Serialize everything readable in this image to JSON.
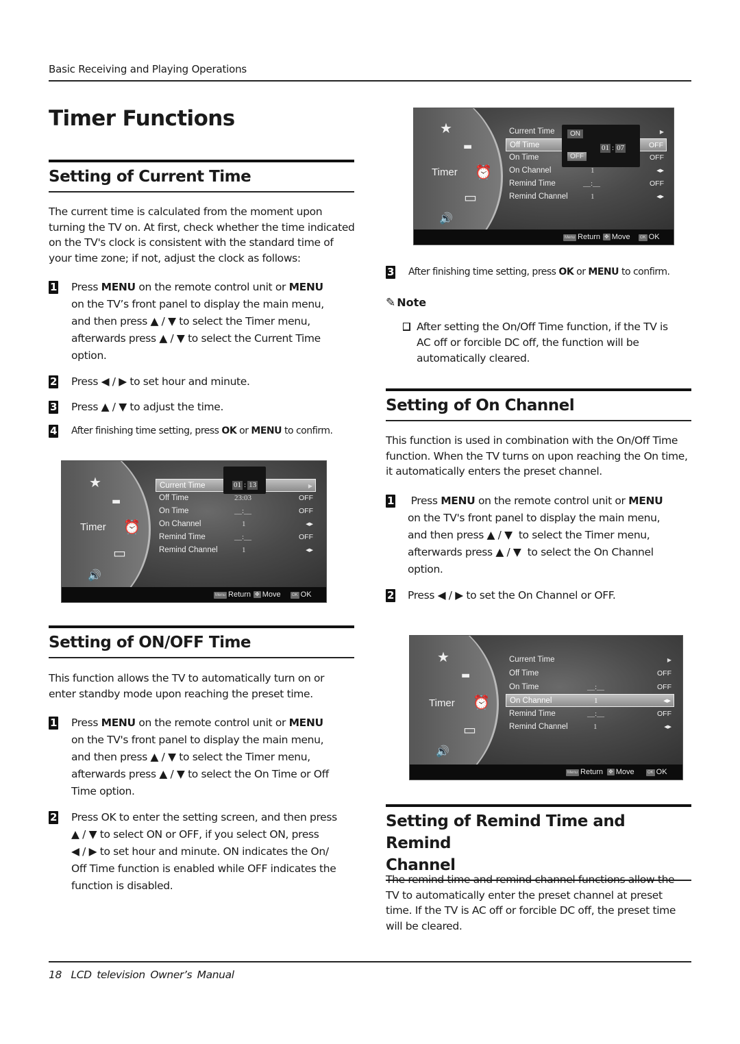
{
  "header": {
    "section": "Basic Receiving and Playing Operations"
  },
  "page_title": "Timer Functions",
  "current_time": {
    "heading": "Setting of Current Time",
    "intro": "The current time is calculated from the moment upon turning the TV on. At first, check whether the time indicated on the TV's clock is consistent with the standard time of your time zone; if not, adjust the clock as follows:",
    "steps": [
      {
        "num": "1",
        "lines": [
          "Press MENU on the remote control unit or MENU",
          "on the TV’s front panel to display the main menu,",
          "and then press ▲ / ▼  to select the Timer menu,",
          "afterwards press ▲ / ▼  to select the Current Time",
          "option."
        ]
      },
      {
        "num": "2",
        "text": "Press ◀ / ▶ to set hour and minute."
      },
      {
        "num": "3",
        "text": "Press ▲ / ▼  to adjust the time."
      },
      {
        "num": "4",
        "text": "After finishing time setting, press OK or MENU to confirm."
      }
    ]
  },
  "on_off_time": {
    "heading": "Setting of ON/OFF Time",
    "intro": "This function allows the TV to automatically turn on or enter standby mode upon reaching the preset time.",
    "steps": [
      {
        "num": "1",
        "lines": [
          "Press MENU on the remote control unit or MENU",
          "on the TV's front panel to display the main menu,",
          "and then press ▲ / ▼  to select the Timer menu,",
          "afterwards press ▲ / ▼  to select the On Time or Off",
          "Time option."
        ]
      },
      {
        "num": "2",
        "lines": [
          "Press OK to enter the setting screen, and then press",
          "▲ / ▼ to select ON or OFF, if you select ON, press",
          "◀ / ▶  to set hour and minute. ON indicates the On/",
          "Off Time function is enabled while OFF indicates the",
          "function is disabled."
        ]
      }
    ],
    "step3": {
      "num": "3",
      "text": "After finishing time setting, press OK or MENU to confirm."
    },
    "note": {
      "heading": "Note",
      "item": "After setting the On/Off Time function, if the TV is AC off or forcible DC off, the function will be automatically cleared."
    }
  },
  "on_channel": {
    "heading": "Setting of On Channel",
    "intro": "This function is used in combination with the On/Off Time function. When the TV turns on upon reaching the On time, it automatically enters the preset channel.",
    "steps": [
      {
        "num": "1",
        "lines": [
          " Press MENU on the remote control unit or MENU",
          "on the TV's front panel to display the main menu,",
          "and then press ▲ / ▼  to select the Timer menu,",
          "afterwards press ▲ / ▼  to select the On Channel",
          "option."
        ]
      },
      {
        "num": "2",
        "text": "Press ◀ / ▶ to set the On Channel or OFF."
      }
    ]
  },
  "remind": {
    "heading_line1": "Setting of Remind Time and Remind",
    "heading_line2": "Channel",
    "intro": "The remind time and remind channel functions allow the TV to automatically enter the preset channel at preset time. If the TV is AC off or forcible DC off, the preset time will be cleared."
  },
  "tv_menus": [
    {
      "id": "current-time-screen",
      "category": "Timer",
      "rows": [
        {
          "label": "Current Time",
          "value": "",
          "status": "▶",
          "selected": true
        },
        {
          "label": "Off Time",
          "value": "23:03",
          "status": "OFF"
        },
        {
          "label": "On Time",
          "value": "__:__",
          "status": "OFF"
        },
        {
          "label": "On Channel",
          "value": "1",
          "status": "◀▶"
        },
        {
          "label": "Remind Time",
          "value": "__:__",
          "status": "OFF"
        },
        {
          "label": "Remind Channel",
          "value": "1",
          "status": "◀▶"
        }
      ],
      "popup": {
        "hour": "01",
        "minute": "13"
      },
      "footer": {
        "return": "Return",
        "move": "Move",
        "ok": "OK",
        "menu_key": "Menu",
        "ok_key": "OK"
      }
    },
    {
      "id": "off-time-screen",
      "category": "Timer",
      "rows": [
        {
          "label": "Current Time",
          "value": "",
          "status": "▶"
        },
        {
          "label": "Off Time",
          "value": "",
          "status": "OFF",
          "selected": true
        },
        {
          "label": "On Time",
          "value": "",
          "status": "OFF"
        },
        {
          "label": "On Channel",
          "value": "1",
          "status": "◀▶"
        },
        {
          "label": "Remind Time",
          "value": "__:__",
          "status": "OFF"
        },
        {
          "label": "Remind Channel",
          "value": "1",
          "status": "◀▶"
        }
      ],
      "popup": {
        "on": "ON",
        "off": "OFF",
        "hour": "01",
        "minute": "07"
      },
      "footer": {
        "return": "Return",
        "move": "Move",
        "ok": "OK",
        "menu_key": "Menu",
        "ok_key": "OK"
      }
    },
    {
      "id": "on-channel-screen",
      "category": "Timer",
      "rows": [
        {
          "label": "Current Time",
          "value": "",
          "status": "▶"
        },
        {
          "label": "Off Time",
          "value": "",
          "status": "OFF"
        },
        {
          "label": "On Time",
          "value": "__:__",
          "status": "OFF"
        },
        {
          "label": "On Channel",
          "value": "1",
          "status": "◀▶",
          "selected": true
        },
        {
          "label": "Remind Time",
          "value": "__:__",
          "status": "OFF"
        },
        {
          "label": "Remind Channel",
          "value": "1",
          "status": "◀▶"
        }
      ],
      "footer": {
        "return": "Return",
        "move": "Move",
        "ok": "OK",
        "menu_key": "Menu",
        "ok_key": "OK"
      }
    }
  ],
  "footer": {
    "page_number": "18",
    "manual_title": "LCD television  Owner’s Manual"
  }
}
